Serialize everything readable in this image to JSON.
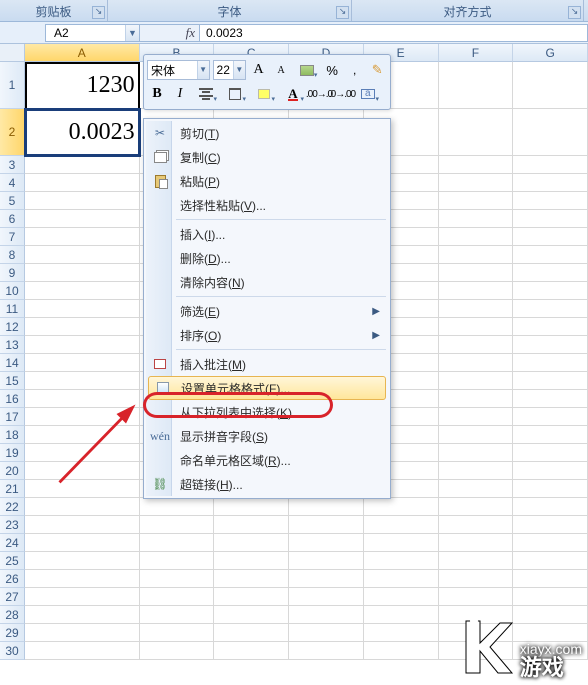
{
  "ribbon": {
    "clipboard_label": "剪贴板",
    "font_label": "字体",
    "align_label": "对齐方式"
  },
  "namebox": {
    "ref": "A2"
  },
  "formula": {
    "value": "0.0023"
  },
  "columns": [
    "A",
    "B",
    "C",
    "D",
    "E",
    "F",
    "G"
  ],
  "row_labels": [
    "1",
    "2",
    "3",
    "4",
    "5",
    "6",
    "7",
    "8",
    "9",
    "10",
    "11",
    "12",
    "13",
    "14",
    "15",
    "16",
    "17",
    "18",
    "19",
    "20",
    "21",
    "22",
    "23",
    "24",
    "25",
    "26",
    "27",
    "28",
    "29",
    "30"
  ],
  "cells": {
    "A1": "1230",
    "A2": "0.0023"
  },
  "mini_toolbar": {
    "font_name": "宋体",
    "font_size": "22",
    "percent": "%"
  },
  "context_menu": {
    "cut": {
      "label": "剪切(",
      "key": "T",
      "suffix": ")"
    },
    "copy": {
      "label": "复制(",
      "key": "C",
      "suffix": ")"
    },
    "paste": {
      "label": "粘贴(",
      "key": "P",
      "suffix": ")"
    },
    "paste_special": {
      "label": "选择性粘贴(",
      "key": "V",
      "suffix": ")..."
    },
    "insert": {
      "label": "插入(",
      "key": "I",
      "suffix": ")..."
    },
    "delete": {
      "label": "删除(",
      "key": "D",
      "suffix": ")..."
    },
    "clear": {
      "label": "清除内容(",
      "key": "N",
      "suffix": ")"
    },
    "filter": {
      "label": "筛选(",
      "key": "E",
      "suffix": ")"
    },
    "sort": {
      "label": "排序(",
      "key": "O",
      "suffix": ")"
    },
    "comment": {
      "label": "插入批注(",
      "key": "M",
      "suffix": ")"
    },
    "format_cells": {
      "label": "设置单元格格式(",
      "key": "F",
      "suffix": ")..."
    },
    "dropdown_pick": {
      "label": "从下拉列表中选择(",
      "key": "K",
      "suffix": ")..."
    },
    "pinyin": {
      "label": "显示拼音字段(",
      "key": "S",
      "suffix": ")"
    },
    "name_range": {
      "label": "命名单元格区域(",
      "key": "R",
      "suffix": ")..."
    },
    "hyperlink": {
      "label": "超链接(",
      "key": "H",
      "suffix": ")..."
    }
  },
  "watermark": {
    "url": "xiayx.com",
    "brand": "游戏"
  }
}
